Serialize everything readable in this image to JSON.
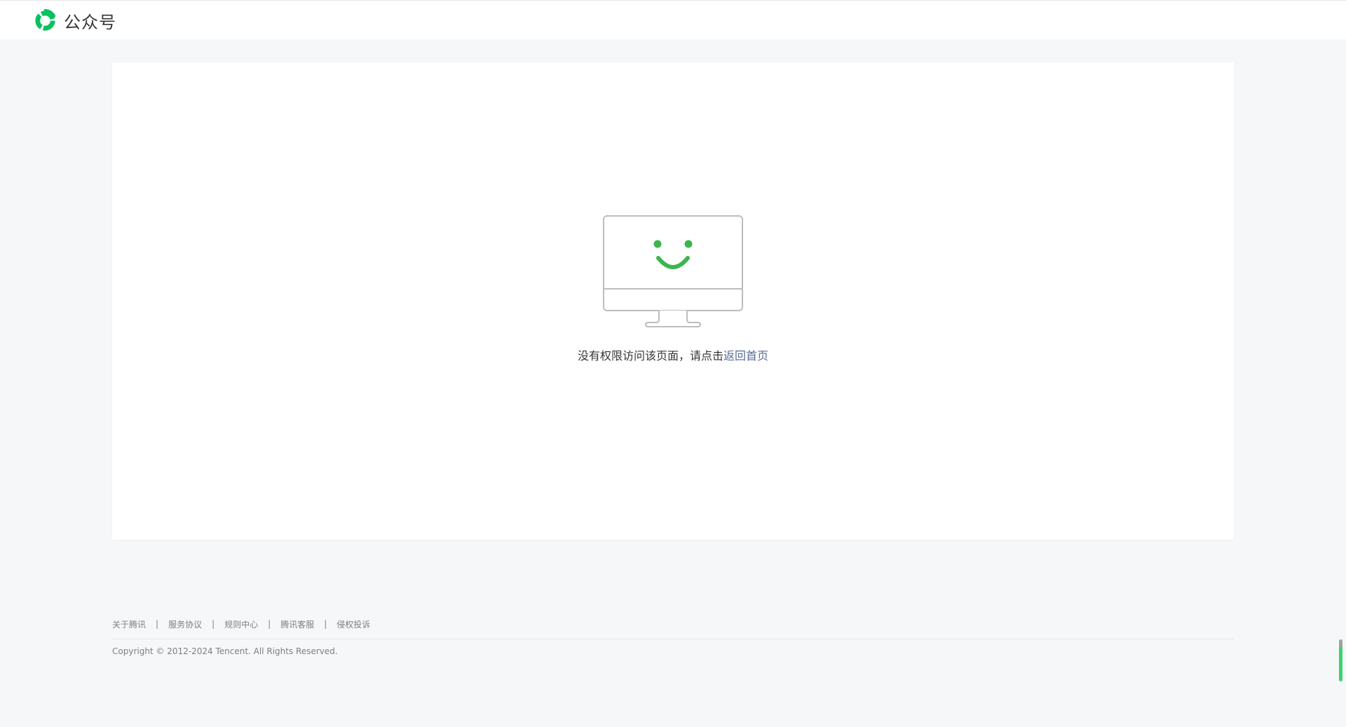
{
  "header": {
    "logo_text": "公众号",
    "brand_color": "#07c160"
  },
  "error": {
    "message_prefix": "没有权限访问该页面，请点击",
    "link_label": "返回首页",
    "illustration": "monitor-smile-icon",
    "accent_color": "#3cb64b",
    "link_color": "#576b95"
  },
  "footer": {
    "links": [
      "关于腾讯",
      "服务协议",
      "规则中心",
      "腾讯客服",
      "侵权投诉"
    ],
    "separator": "|",
    "copyright": "Copyright © 2012-2024 Tencent. All Rights Reserved."
  }
}
